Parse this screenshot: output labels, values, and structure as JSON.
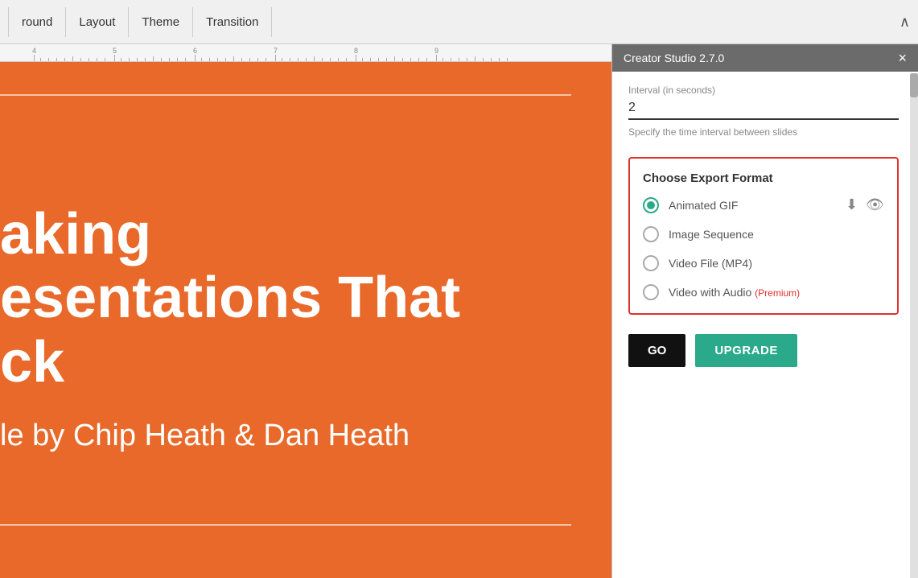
{
  "nav": {
    "tabs": [
      {
        "label": "round",
        "id": "background"
      },
      {
        "label": "Layout",
        "id": "layout"
      },
      {
        "label": "Theme",
        "id": "theme"
      },
      {
        "label": "Transition",
        "id": "transition"
      }
    ],
    "chevron": "∧"
  },
  "ruler": {
    "marks": [
      {
        "pos": 40,
        "label": "4"
      },
      {
        "pos": 140,
        "label": "5"
      },
      {
        "pos": 240,
        "label": "6"
      },
      {
        "pos": 340,
        "label": "7"
      },
      {
        "pos": 440,
        "label": "8"
      },
      {
        "pos": 540,
        "label": "9"
      }
    ]
  },
  "slide": {
    "title_lines": [
      "aking",
      "esentations That",
      "ck"
    ],
    "subtitle": "le by Chip Heath & Dan Heath",
    "bg_color": "#e8692a"
  },
  "panel": {
    "title": "Creator Studio 2.7.0",
    "close_label": "×",
    "interval_label": "Interval (in seconds)",
    "interval_value": "2",
    "interval_hint": "Specify the time interval between slides",
    "export_section_title": "Choose Export Format",
    "export_options": [
      {
        "id": "animated-gif",
        "label": "Animated GIF",
        "selected": true,
        "premium": false,
        "premium_label": ""
      },
      {
        "id": "image-sequence",
        "label": "Image Sequence",
        "selected": false,
        "premium": false,
        "premium_label": ""
      },
      {
        "id": "video-mp4",
        "label": "Video File (MP4)",
        "selected": false,
        "premium": false,
        "premium_label": ""
      },
      {
        "id": "video-audio",
        "label": "Video with Audio",
        "selected": false,
        "premium": true,
        "premium_label": "(Premium)"
      }
    ],
    "go_label": "GO",
    "upgrade_label": "UPGRADE"
  }
}
